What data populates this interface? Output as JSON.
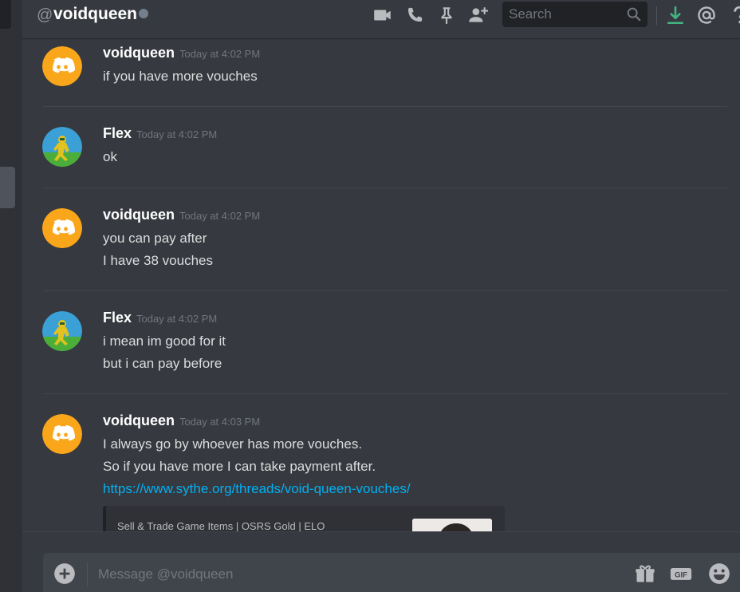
{
  "header": {
    "at_symbol": "@",
    "dm_name": "voidqueen",
    "search_placeholder": "Search",
    "icons": [
      "video-call-icon",
      "voice-call-icon",
      "pin-icon",
      "add-friend-icon",
      "search-icon",
      "download-icon",
      "mention-icon",
      "help-icon"
    ]
  },
  "messages": [
    {
      "author": "voidqueen",
      "timestamp": "Today at 4:02 PM",
      "lines": [
        "if you have more vouches"
      ]
    },
    {
      "author": "Flex",
      "timestamp": "Today at 4:02 PM",
      "lines": [
        "ok"
      ]
    },
    {
      "author": "voidqueen",
      "timestamp": "Today at 4:02 PM",
      "lines": [
        "you can pay after",
        "I have 38 vouches"
      ]
    },
    {
      "author": "Flex",
      "timestamp": "Today at 4:02 PM",
      "lines": [
        "i mean im good for it",
        "but i can pay before"
      ]
    },
    {
      "author": "voidqueen",
      "timestamp": "Today at 4:03 PM",
      "lines": [
        "I always go by whoever has more vouches.",
        "So if you have more I can take payment after."
      ],
      "link": "https://www.sythe.org/threads/void-queen-vouches/",
      "embed_provider": "Sell & Trade Game Items | OSRS Gold | ELO"
    }
  ],
  "composer": {
    "placeholder": "Message @voidqueen",
    "icons": [
      "add-attachment-icon",
      "gift-icon",
      "gif-icon",
      "emoji-icon"
    ],
    "gif_label": "GIF"
  },
  "colors": {
    "background": "#36393f",
    "text": "#dcddde",
    "timestamp": "#72767d",
    "link": "#00b0f4",
    "discord_avatar": "#faa61a",
    "download_green": "#43b581"
  }
}
